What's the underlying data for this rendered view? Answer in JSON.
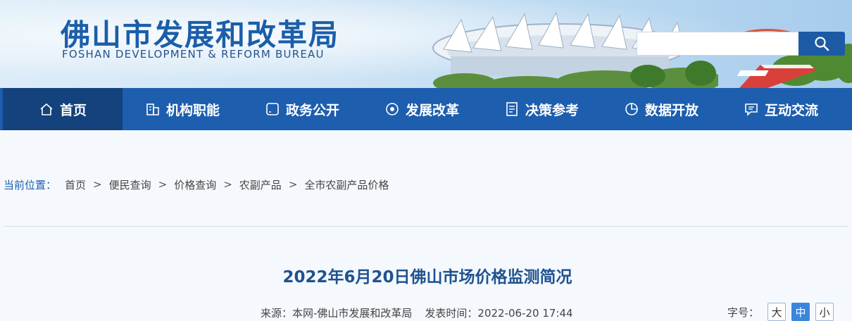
{
  "header": {
    "title_cn": "佛山市发展和改革局",
    "title_en": "FOSHAN DEVELOPMENT & REFORM BUREAU",
    "search_placeholder": ""
  },
  "nav": {
    "items": [
      {
        "label": "首页",
        "icon": "home-icon"
      },
      {
        "label": "机构职能",
        "icon": "building-icon"
      },
      {
        "label": "政务公开",
        "icon": "square-icon"
      },
      {
        "label": "发展改革",
        "icon": "target-icon"
      },
      {
        "label": "决策参考",
        "icon": "document-icon"
      },
      {
        "label": "数据开放",
        "icon": "pie-chart-icon"
      },
      {
        "label": "互动交流",
        "icon": "chat-icon"
      }
    ],
    "active_index": 0
  },
  "breadcrumb": {
    "label": "当前位置：",
    "items": [
      "首页",
      "便民查询",
      "价格查询",
      "农副产品",
      "全市农副产品价格"
    ],
    "separator": ">"
  },
  "article": {
    "title": "2022年6月20日佛山市场价格监测简况",
    "source": "来源：本网-佛山市发展和改革局",
    "publish_time": "发表时间：2022-06-20 17:44",
    "font_size_label": "字号：",
    "font_sizes": [
      "大",
      "中",
      "小"
    ],
    "font_size_active": "中"
  },
  "colors": {
    "nav_bg": "#1d5eae",
    "nav_active_bg": "#13427c",
    "title_color": "#1f5290",
    "accent": "#3a86dd"
  }
}
